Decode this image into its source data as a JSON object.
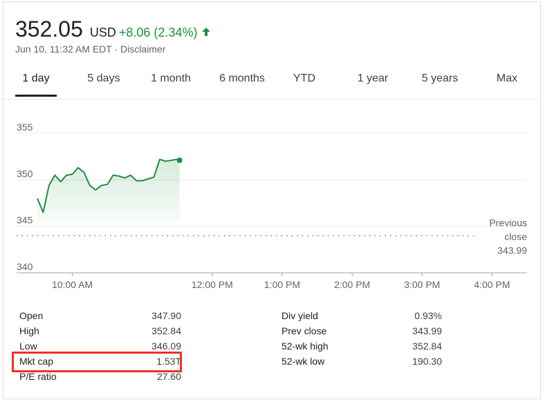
{
  "quote": {
    "price": "352.05",
    "currency": "USD",
    "change": "+8.06 (2.34%)",
    "timestamp": "Jun 10, 11:32 AM EDT",
    "separator": " · ",
    "disclaimer": "Disclaimer",
    "color_up": "#1e8e3e"
  },
  "tabs": [
    {
      "label": "1 day",
      "active": true
    },
    {
      "label": "5 days"
    },
    {
      "label": "1 month"
    },
    {
      "label": "6 months"
    },
    {
      "label": "YTD"
    },
    {
      "label": "1 year"
    },
    {
      "label": "5 years"
    },
    {
      "label": "Max"
    }
  ],
  "chart_data": {
    "type": "line",
    "title": "",
    "xlabel": "",
    "ylabel": "",
    "ylim": [
      340,
      356.5
    ],
    "y_ticks": [
      340,
      345,
      350,
      355
    ],
    "x_ticks": [
      "10:00 AM",
      "12:00 PM",
      "1:00 PM",
      "2:00 PM",
      "3:00 PM",
      "4:00 PM"
    ],
    "x_tick_minutes": [
      600,
      720,
      780,
      840,
      900,
      960
    ],
    "x_range_minutes": [
      570,
      990
    ],
    "previous_close": 343.99,
    "previous_close_label": [
      "Previous",
      "close",
      "343.99"
    ],
    "line_color": "#1e8e3e",
    "series": [
      {
        "x": [
          570,
          575,
          580,
          585,
          590,
          595,
          600,
          605,
          610,
          615,
          620,
          625,
          630,
          635,
          640,
          645,
          650,
          655,
          660,
          665,
          670,
          675,
          680,
          685,
          690,
          692
        ],
        "y": [
          348.0,
          346.5,
          349.4,
          350.5,
          349.8,
          350.5,
          350.6,
          351.3,
          350.8,
          349.4,
          348.9,
          349.4,
          349.5,
          350.5,
          350.4,
          350.2,
          350.5,
          349.9,
          349.9,
          350.1,
          350.3,
          352.2,
          352.0,
          352.1,
          352.2,
          352.1
        ]
      }
    ]
  },
  "stats_left": [
    {
      "label": "Open",
      "value": "347.90"
    },
    {
      "label": "High",
      "value": "352.84"
    },
    {
      "label": "Low",
      "value": "346.09"
    },
    {
      "label": "Mkt cap",
      "value": "1.53T"
    },
    {
      "label": "P/E ratio",
      "value": "27.60"
    }
  ],
  "stats_right": [
    {
      "label": "Div yield",
      "value": "0.93%"
    },
    {
      "label": "Prev close",
      "value": "343.99"
    },
    {
      "label": "52-wk high",
      "value": "352.84"
    },
    {
      "label": "52-wk low",
      "value": "190.30"
    }
  ],
  "highlight_color": "#ea3323"
}
